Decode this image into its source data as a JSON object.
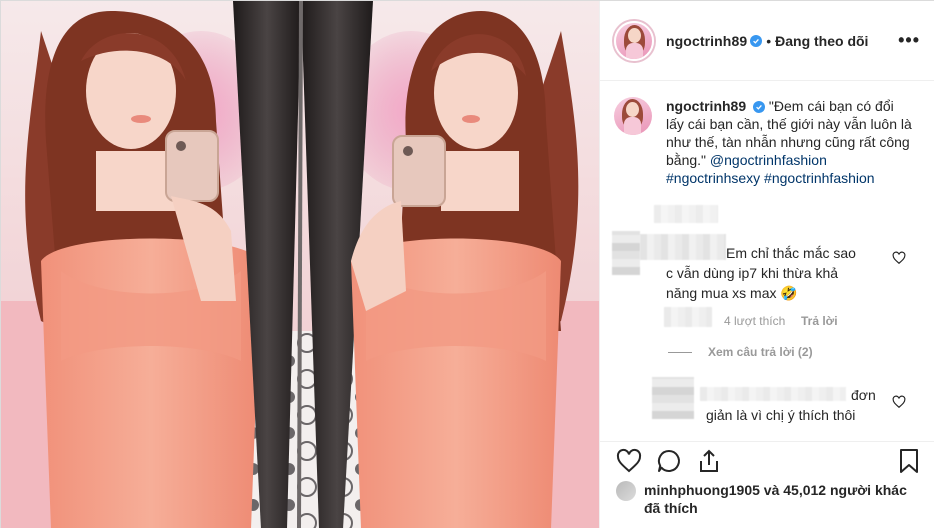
{
  "post": {
    "username": "ngoctrinh89",
    "verified": true,
    "follow_state": "Đang theo dõi",
    "dot": "•",
    "more_label": "•••"
  },
  "caption": {
    "username": "ngoctrinh89",
    "text": "\"Đem cái bạn có đổi lấy cái bạn cần, thế giới này vẫn luôn là như thế, tàn nhẫn nhưng cũng rất công bằng.\"",
    "mention": "@ngoctrinhfashion",
    "hashtags": "#ngoctrinhsexy #ngoctrinhfashion"
  },
  "comments": [
    {
      "text": "Em chỉ thắc mắc sao c vẫn dùng ip7 khi thừa khả năng mua xs max 🤣",
      "likes_label": "4 lượt thích",
      "reply_label": "Trả lời"
    }
  ],
  "view_replies": "Xem câu trả lời (2)",
  "reply": {
    "text_line1": "đơn",
    "text_line2": "giản là vì chị ý thích thôi"
  },
  "likes": {
    "name": "minhphuong1905",
    "text": "và 45,012 người khác",
    "line2": "đã thích"
  },
  "icons": {
    "like": "heart-icon",
    "comment": "comment-icon",
    "share": "share-icon",
    "save": "bookmark-icon",
    "comment_like": "heart-icon"
  },
  "colors": {
    "link": "#003569",
    "verified": "#3897f0",
    "meta": "#999999",
    "dress": "#f4a38d",
    "hair": "#8a3b2a",
    "mirror": "#2f2b2b"
  }
}
